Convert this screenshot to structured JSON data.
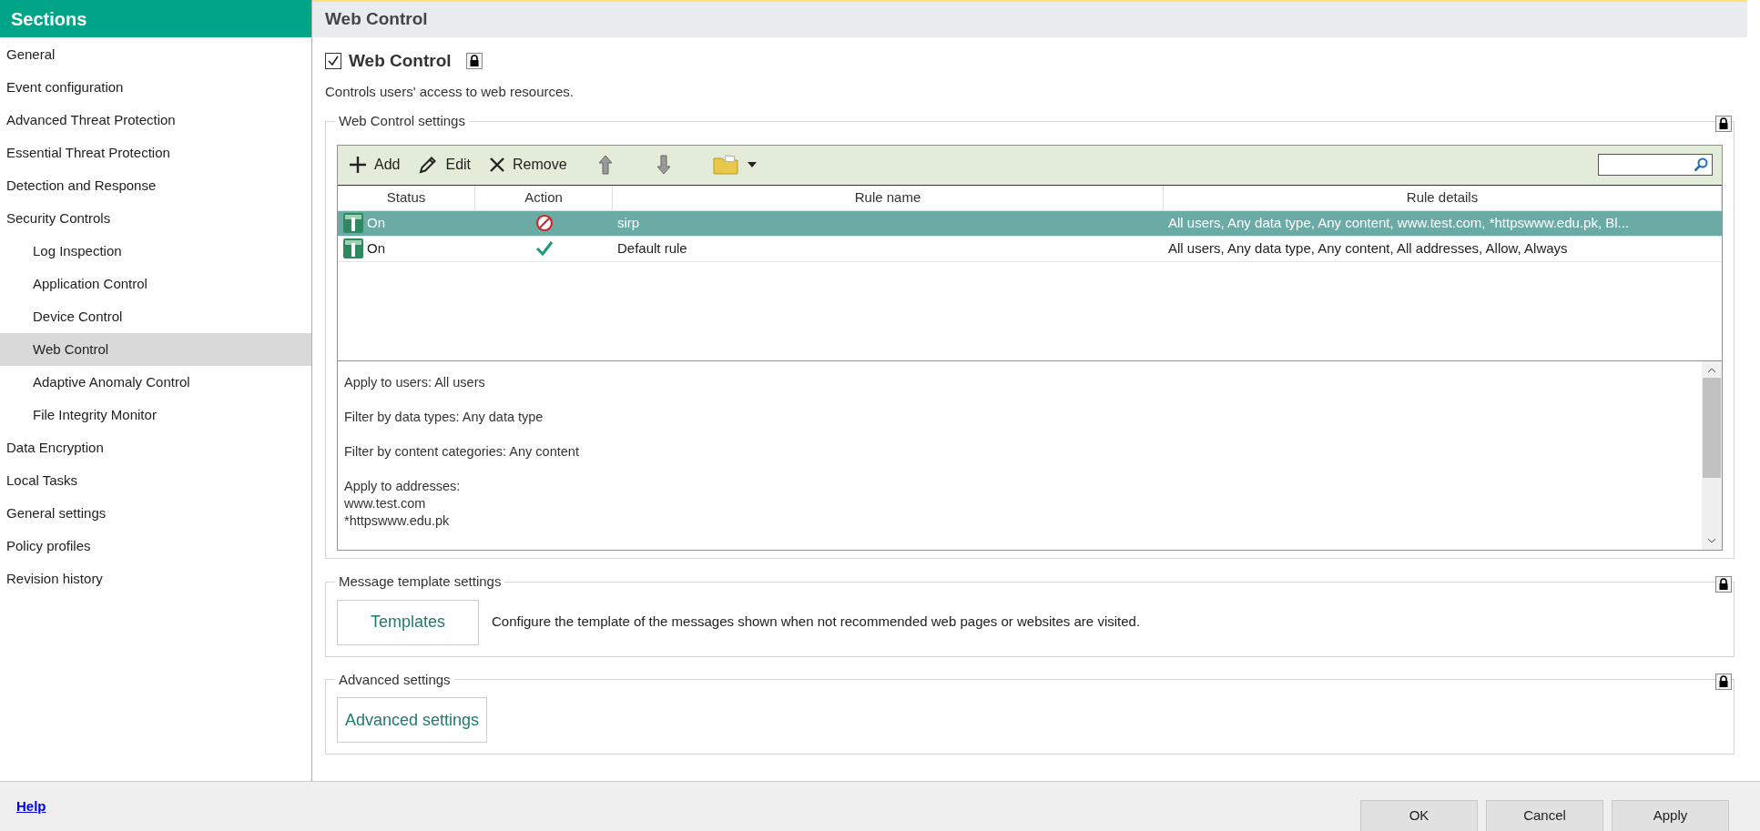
{
  "sidebar": {
    "title": "Sections",
    "items": [
      {
        "label": "General",
        "selected": false
      },
      {
        "label": "Event configuration",
        "selected": false
      },
      {
        "label": "Advanced Threat Protection",
        "selected": false
      },
      {
        "label": "Essential Threat Protection",
        "selected": false
      },
      {
        "label": "Detection and Response",
        "selected": false
      },
      {
        "label": "Security Controls",
        "selected": false,
        "children": [
          {
            "label": "Log Inspection",
            "selected": false
          },
          {
            "label": "Application Control",
            "selected": false
          },
          {
            "label": "Device Control",
            "selected": false
          },
          {
            "label": "Web Control",
            "selected": true
          },
          {
            "label": "Adaptive Anomaly Control",
            "selected": false
          },
          {
            "label": "File Integrity Monitor",
            "selected": false
          }
        ]
      },
      {
        "label": "Data Encryption",
        "selected": false
      },
      {
        "label": "Local Tasks",
        "selected": false
      },
      {
        "label": "General settings",
        "selected": false
      },
      {
        "label": "Policy profiles",
        "selected": false
      },
      {
        "label": "Revision history",
        "selected": false
      }
    ]
  },
  "page": {
    "title": "Web Control",
    "enable": {
      "label": "Web Control",
      "checked": true
    },
    "description": "Controls users' access to web resources."
  },
  "web_control_settings": {
    "legend": "Web Control settings",
    "toolbar": [
      {
        "kind": "add",
        "label": "Add"
      },
      {
        "kind": "edit",
        "label": "Edit"
      },
      {
        "kind": "remove",
        "label": "Remove"
      },
      {
        "kind": "up"
      },
      {
        "kind": "down"
      },
      {
        "kind": "folder"
      }
    ],
    "columns": [
      "Status",
      "Action",
      "Rule name",
      "Rule details"
    ],
    "rows": [
      {
        "selected": true,
        "status": "On",
        "kind": "block",
        "rule_name": "sirp",
        "rule_details": "All users, Any data type, Any content, www.test.com, *httpswww.edu.pk, Bl..."
      },
      {
        "selected": false,
        "status": "On",
        "kind": "allow",
        "rule_name": "Default rule",
        "rule_details": "All users, Any data type, Any content, All addresses, Allow, Always"
      }
    ],
    "details": [
      {
        "lines": [
          "Apply to users: All users"
        ]
      },
      {
        "lines": [
          "Filter by data types: Any data type"
        ]
      },
      {
        "lines": [
          "Filter by content categories: Any content"
        ]
      },
      {
        "lines": [
          "Apply to addresses:",
          "www.test.com",
          "*httpswww.edu.pk"
        ]
      }
    ]
  },
  "message_template_settings": {
    "legend": "Message template settings",
    "button": "Templates",
    "description": "Configure the template of the messages shown when not recommended web pages or websites are visited."
  },
  "advanced_settings": {
    "legend": "Advanced settings",
    "button": "Advanced settings"
  },
  "footer": {
    "help": "Help",
    "buttons": [
      "OK",
      "Cancel",
      "Apply"
    ]
  }
}
